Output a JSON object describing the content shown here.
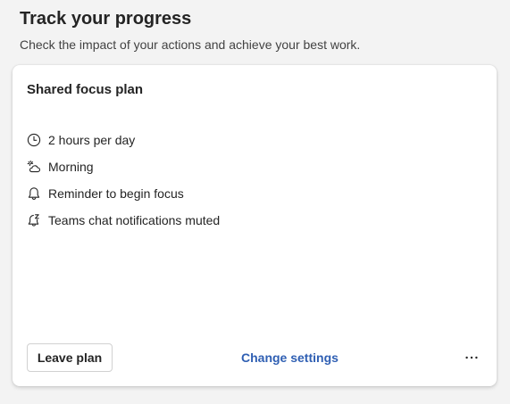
{
  "header": {
    "title": "Track your progress",
    "subtitle": "Check the impact of your actions and achieve your best work."
  },
  "card": {
    "title": "Shared focus plan",
    "details": [
      {
        "icon": "clock-icon",
        "text": "2 hours per day"
      },
      {
        "icon": "weather-partly-cloudy-icon",
        "text": "Morning"
      },
      {
        "icon": "bell-icon",
        "text": "Reminder to begin focus"
      },
      {
        "icon": "chat-snooze-icon",
        "text": "Teams chat notifications muted"
      }
    ],
    "leave_label": "Leave plan",
    "change_label": "Change settings",
    "more_icon": "more-horizontal-icon"
  },
  "colors": {
    "accent_link": "#2f5fb3",
    "background": "#f3f3f3",
    "card": "#ffffff"
  }
}
